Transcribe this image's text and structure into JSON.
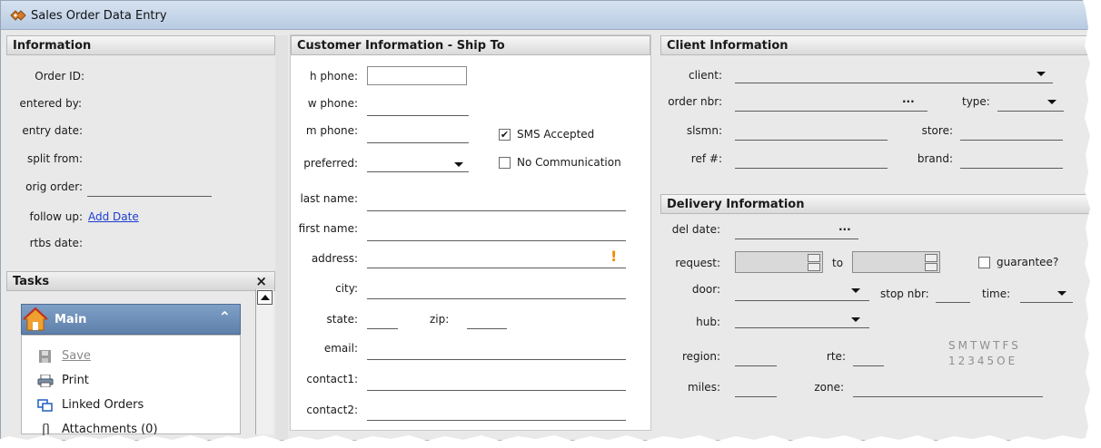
{
  "window": {
    "title": "Sales Order Data Entry"
  },
  "info": {
    "header": "Information",
    "order_id_label": "Order ID:",
    "entered_by_label": "entered by:",
    "entry_date_label": "entry date:",
    "split_from_label": "split from:",
    "orig_order_label": "orig order:",
    "follow_up_label": "follow up:",
    "add_date_link": "Add Date",
    "rtbs_date_label": "rtbs date:"
  },
  "tasks": {
    "header": "Tasks",
    "close_glyph": "×",
    "main_label": "Main",
    "collapse_glyph": "⌃",
    "items": [
      {
        "label": "Save",
        "icon": "save-icon",
        "enabled": false
      },
      {
        "label": "Print",
        "icon": "print-icon",
        "enabled": true
      },
      {
        "label": "Linked Orders",
        "icon": "linked-orders-icon",
        "enabled": true
      },
      {
        "label": "Attachments (0)",
        "icon": "paperclip-icon",
        "enabled": true
      }
    ]
  },
  "ship_to": {
    "header": "Customer Information - Ship To",
    "h_phone": "h phone:",
    "w_phone": "w phone:",
    "m_phone": "m phone:",
    "preferred": "preferred:",
    "sms_accepted": "SMS Accepted",
    "sms_checked": true,
    "no_communication": "No Communication",
    "no_comm_checked": false,
    "last_name": "last name:",
    "first_name": "first name:",
    "address": "address:",
    "address_warning": "!",
    "city": "city:",
    "state": "state:",
    "zip": "zip:",
    "email": "email:",
    "contact1": "contact1:",
    "contact2": "contact2:"
  },
  "client": {
    "header": "Client Information",
    "client_label": "client:",
    "order_nbr_label": "order nbr:",
    "order_nbr_ellipsis": "...",
    "type_label": "type:",
    "slsmn_label": "slsmn:",
    "store_label": "store:",
    "ref_label": "ref #:",
    "brand_label": "brand:"
  },
  "delivery": {
    "header": "Delivery Information",
    "del_date_label": "del date:",
    "del_date_ellipsis": "...",
    "request_label": "request:",
    "to_label": "to",
    "guarantee_label": "guarantee?",
    "guarantee_checked": false,
    "door_label": "door:",
    "stop_nbr_label": "stop nbr:",
    "time_label": "time:",
    "hub_label": "hub:",
    "region_label": "region:",
    "rte_label": "rte:",
    "miles_label": "miles:",
    "zone_label": "zone:",
    "week_days": "SMTWTFS",
    "week_numbers": "12345OE"
  }
}
